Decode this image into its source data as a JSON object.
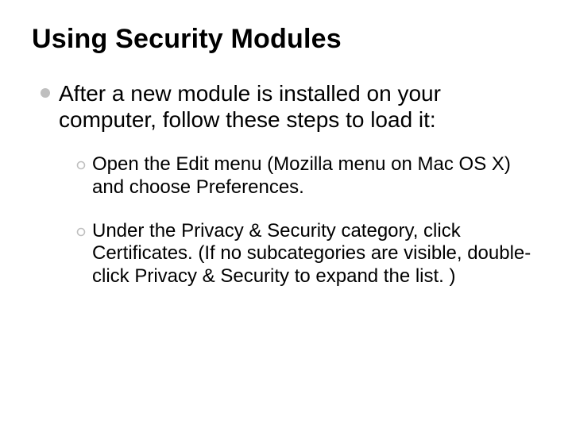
{
  "slide": {
    "title": "Using Security Modules",
    "intro": "After a new module is installed on your computer, follow these steps to load it:",
    "steps": [
      "Open the Edit menu (Mozilla menu on Mac OS X) and choose Preferences.",
      "Under the Privacy & Security category, click Certificates. (If no subcategories are visible, double-click Privacy & Security to expand the list. )"
    ]
  }
}
